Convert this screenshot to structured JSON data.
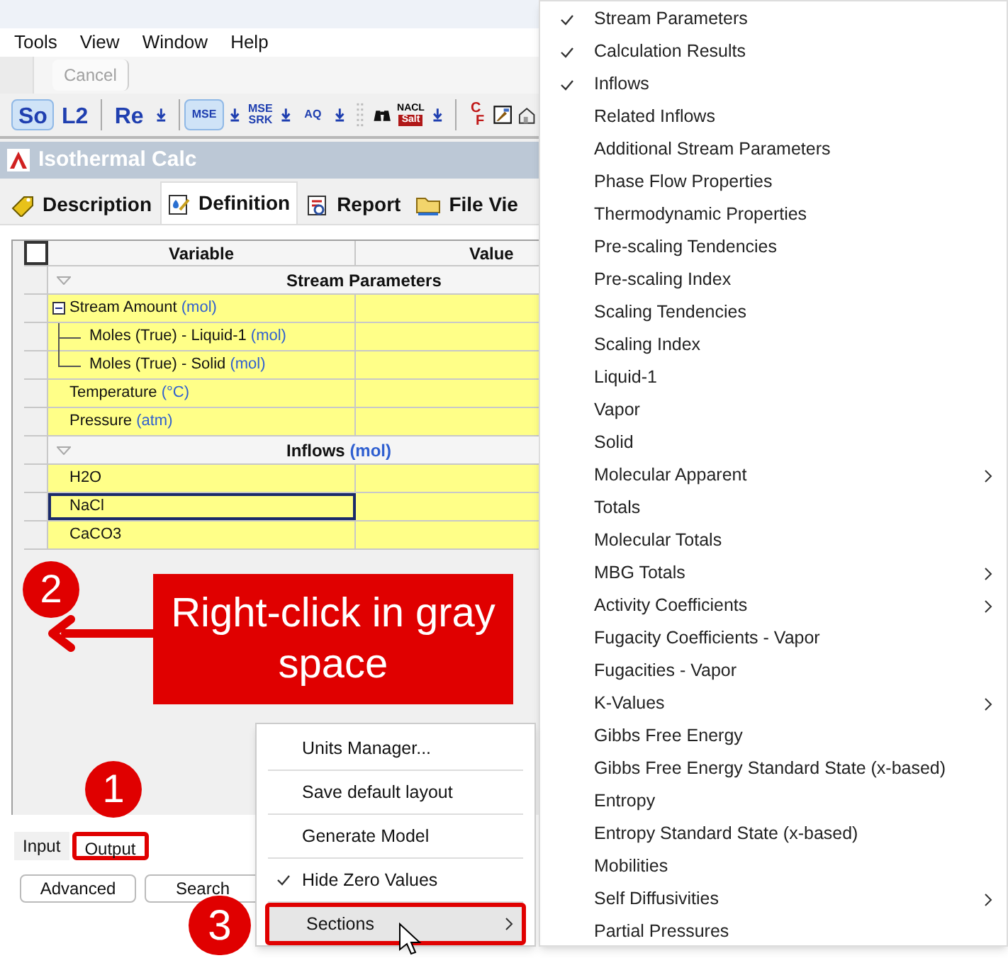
{
  "menubar": [
    "Tools",
    "View",
    "Window",
    "Help"
  ],
  "cancel_button": {
    "label": "Cancel",
    "disabled": true
  },
  "toolbar": [
    {
      "kind": "text",
      "label": "So",
      "selected": true
    },
    {
      "kind": "text",
      "label": "L2",
      "selected": false
    },
    {
      "kind": "sep"
    },
    {
      "kind": "text",
      "label": "Re",
      "selected": false
    },
    {
      "kind": "down"
    },
    {
      "kind": "sep"
    },
    {
      "kind": "small",
      "label": "MSE",
      "selected": true
    },
    {
      "kind": "down"
    },
    {
      "kind": "stack",
      "top": "MSE",
      "bottom": "SRK"
    },
    {
      "kind": "down"
    },
    {
      "kind": "small",
      "label": "AQ",
      "selected": false
    },
    {
      "kind": "down"
    },
    {
      "kind": "grip"
    },
    {
      "kind": "binoculars"
    },
    {
      "kind": "salt",
      "top": "NACL",
      "bottom": "Salt"
    },
    {
      "kind": "down"
    },
    {
      "kind": "sep"
    },
    {
      "kind": "convert",
      "top": "C",
      "bottom": "F"
    },
    {
      "kind": "frame"
    },
    {
      "kind": "house"
    }
  ],
  "document": {
    "title": "Isothermal Calc"
  },
  "tabs": [
    {
      "label": "Description",
      "selected": false
    },
    {
      "label": "Definition",
      "selected": true
    },
    {
      "label": "Report",
      "selected": false
    },
    {
      "label": "File Vie",
      "selected": false
    }
  ],
  "grid": {
    "columns": [
      "Variable",
      "Value"
    ],
    "rows": [
      {
        "kind": "section",
        "label": "Stream Parameters"
      },
      {
        "kind": "tree",
        "label": "Stream Amount",
        "unit": "(mol)",
        "expanded": true,
        "children": [
          {
            "label": "Moles (True) - Liquid-1",
            "unit": "(mol)"
          },
          {
            "label": "Moles (True) - Solid",
            "unit": "(mol)"
          }
        ]
      },
      {
        "kind": "row",
        "label": "Temperature",
        "unit": "(°C)",
        "selected": false
      },
      {
        "kind": "row",
        "label": "Pressure",
        "unit": "(atm)",
        "selected": false
      },
      {
        "kind": "section",
        "label": "Inflows",
        "unit": "(mol)"
      },
      {
        "kind": "row",
        "label": "H2O",
        "selected": false
      },
      {
        "kind": "row",
        "label": "NaCl",
        "selected": true
      },
      {
        "kind": "row",
        "label": "CaCO3",
        "selected": false
      }
    ]
  },
  "bottom_tabs": [
    {
      "label": "Input",
      "selected": false,
      "highlighted": false
    },
    {
      "label": "Output",
      "selected": true,
      "highlighted": true
    }
  ],
  "buttons": [
    "Advanced",
    "Search"
  ],
  "context_menu": [
    {
      "label": "Units Manager...",
      "checked": false,
      "submenu": false,
      "highlighted": false
    },
    {
      "label": "Save default layout",
      "checked": false,
      "submenu": false,
      "highlighted": false
    },
    {
      "label": "Generate Model",
      "checked": false,
      "submenu": false,
      "highlighted": false
    },
    {
      "label": "Hide Zero Values",
      "checked": true,
      "submenu": false,
      "highlighted": false
    },
    {
      "label": "Sections",
      "checked": false,
      "submenu": true,
      "highlighted": true
    }
  ],
  "sections_menu": [
    {
      "label": "Stream Parameters",
      "checked": true,
      "submenu": false
    },
    {
      "label": "Calculation Results",
      "checked": true,
      "submenu": false
    },
    {
      "label": "Inflows",
      "checked": true,
      "submenu": false
    },
    {
      "label": "Related Inflows",
      "checked": false,
      "submenu": false
    },
    {
      "label": "Additional Stream Parameters",
      "checked": false,
      "submenu": false
    },
    {
      "label": "Phase Flow Properties",
      "checked": false,
      "submenu": false
    },
    {
      "label": "Thermodynamic Properties",
      "checked": false,
      "submenu": false
    },
    {
      "label": "Pre-scaling Tendencies",
      "checked": false,
      "submenu": false
    },
    {
      "label": "Pre-scaling Index",
      "checked": false,
      "submenu": false
    },
    {
      "label": "Scaling Tendencies",
      "checked": false,
      "submenu": false
    },
    {
      "label": "Scaling Index",
      "checked": false,
      "submenu": false
    },
    {
      "label": "Liquid-1",
      "checked": false,
      "submenu": false
    },
    {
      "label": "Vapor",
      "checked": false,
      "submenu": false
    },
    {
      "label": "Solid",
      "checked": false,
      "submenu": false
    },
    {
      "label": "Molecular Apparent",
      "checked": false,
      "submenu": true
    },
    {
      "label": "Totals",
      "checked": false,
      "submenu": false
    },
    {
      "label": "Molecular Totals",
      "checked": false,
      "submenu": false
    },
    {
      "label": "MBG Totals",
      "checked": false,
      "submenu": true
    },
    {
      "label": "Activity Coefficients",
      "checked": false,
      "submenu": true
    },
    {
      "label": "Fugacity Coefficients - Vapor",
      "checked": false,
      "submenu": false
    },
    {
      "label": "Fugacities - Vapor",
      "checked": false,
      "submenu": false
    },
    {
      "label": "K-Values",
      "checked": false,
      "submenu": true
    },
    {
      "label": "Gibbs Free Energy",
      "checked": false,
      "submenu": false
    },
    {
      "label": "Gibbs Free Energy Standard State (x-based)",
      "checked": false,
      "submenu": false
    },
    {
      "label": "Entropy",
      "checked": false,
      "submenu": false
    },
    {
      "label": "Entropy Standard State (x-based)",
      "checked": false,
      "submenu": false
    },
    {
      "label": "Mobilities",
      "checked": false,
      "submenu": false
    },
    {
      "label": "Self Diffusivities",
      "checked": false,
      "submenu": true
    },
    {
      "label": "Partial Pressures",
      "checked": false,
      "submenu": false
    }
  ],
  "annotations": {
    "steps": [
      "1",
      "2",
      "3"
    ],
    "callout": "Right-click in gray space"
  }
}
